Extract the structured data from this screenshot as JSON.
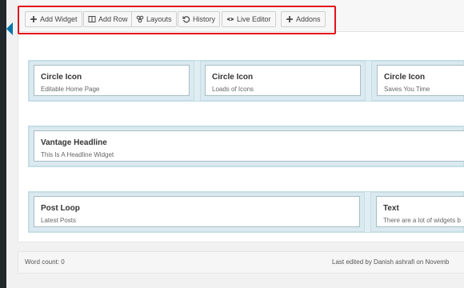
{
  "toolbar": {
    "buttons": [
      {
        "label": "Add Widget",
        "icon": "plus-icon"
      },
      {
        "label": "Add Row",
        "icon": "columns-icon"
      },
      {
        "label": "Layouts",
        "icon": "layouts-icon"
      },
      {
        "label": "History",
        "icon": "history-icon"
      },
      {
        "label": "Live Editor",
        "icon": "eye-icon"
      },
      {
        "label": "Addons",
        "icon": "plus-icon"
      }
    ],
    "highlight_color": "#e3141b"
  },
  "rows": [
    {
      "widgets": [
        {
          "title": "Circle Icon",
          "description": "Editable Home Page"
        },
        {
          "title": "Circle Icon",
          "description": "Loads of Icons"
        },
        {
          "title": "Circle Icon",
          "description": "Saves You Time"
        }
      ]
    },
    {
      "widgets": [
        {
          "title": "Vantage Headline",
          "description": "This Is A Headline Widget"
        }
      ]
    },
    {
      "widgets": [
        {
          "title": "Post Loop",
          "description": "Latest Posts"
        },
        {
          "title": "Text",
          "description": "There are a lot of widgets b"
        }
      ]
    }
  ],
  "footer": {
    "word_count": "Word count: 0",
    "last_edited": "Last edited by Danish ashrafi on Novemb"
  },
  "colors": {
    "row_bg": "#dfeef3",
    "widget_border": "#a8bcc4",
    "admin_accent": "#0073aa"
  }
}
